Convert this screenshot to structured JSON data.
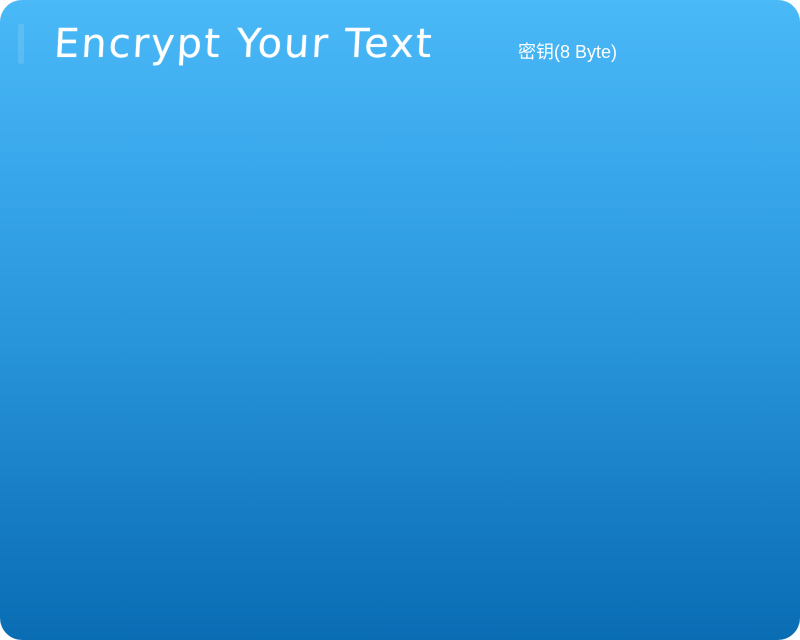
{
  "window": {
    "title": "Encrypt Your Text",
    "key_label": "密钥(8 Byte)"
  },
  "colors": {
    "gradient_top": "#4ab9f7",
    "gradient_bottom": "#0a6db4",
    "text": "#ffffff"
  }
}
